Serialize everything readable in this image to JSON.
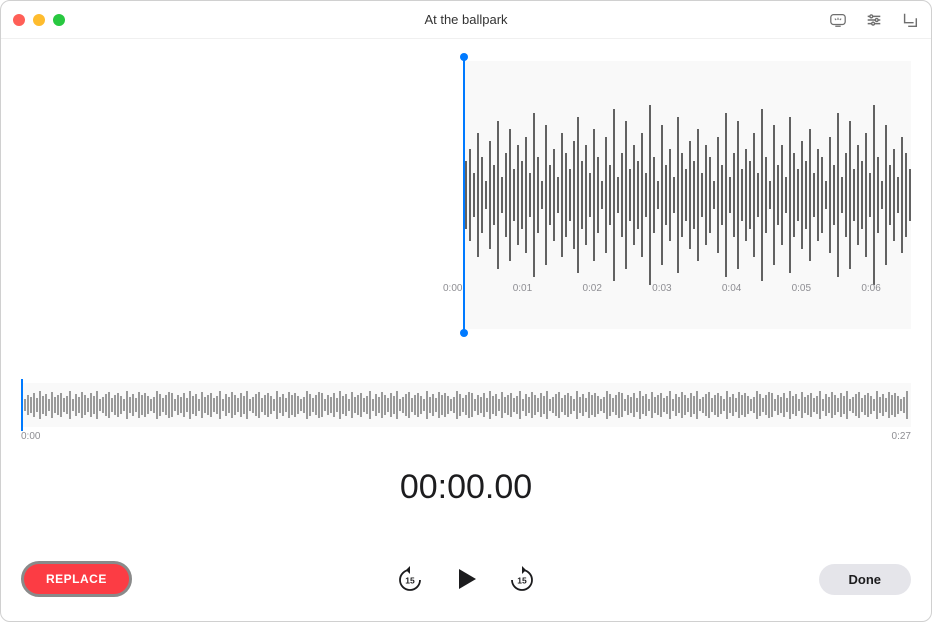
{
  "window": {
    "title": "At the ballpark"
  },
  "main_waveform": {
    "ticks": [
      "0:00",
      "0:01",
      "0:02",
      "0:03",
      "0:04",
      "0:05",
      "0:06"
    ]
  },
  "overview": {
    "start": "0:00",
    "end": "0:27"
  },
  "timer": "00:00.00",
  "buttons": {
    "replace": "REPLACE",
    "done": "Done",
    "skip_seconds": "15"
  }
}
